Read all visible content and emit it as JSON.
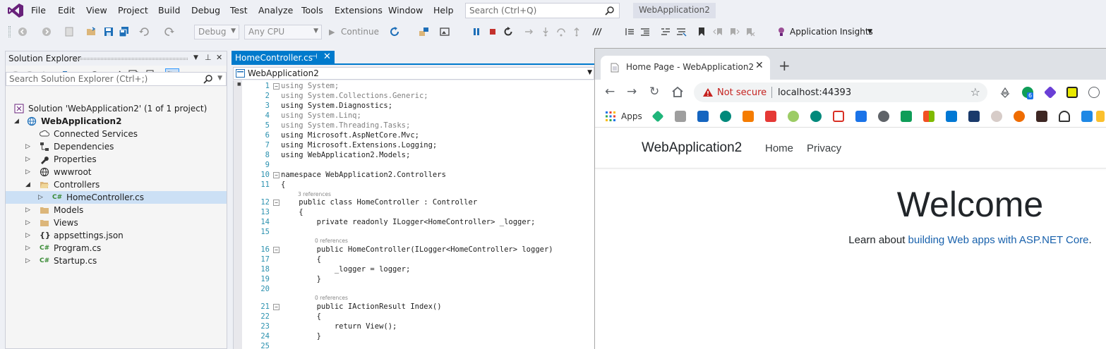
{
  "vs": {
    "menu": [
      "File",
      "Edit",
      "View",
      "Project",
      "Build",
      "Debug",
      "Test",
      "Analyze",
      "Tools",
      "Extensions",
      "Window",
      "Help"
    ],
    "search_placeholder": "Search (Ctrl+Q)",
    "window_title": "WebApplication2",
    "toolbar": {
      "config": "Debug",
      "platform": "Any CPU",
      "continue": "Continue",
      "app_insights": "Application Insights"
    },
    "accent": "#007acc"
  },
  "solution_explorer": {
    "title": "Solution Explorer",
    "search_placeholder": "Search Solution Explorer (Ctrl+;)",
    "items": [
      {
        "label": "Solution 'WebApplication2' (1 of 1 project)",
        "icon": "solution-icon"
      },
      {
        "label": "WebApplication2",
        "icon": "web-project-icon"
      },
      {
        "label": "Connected Services",
        "icon": "connected-services-icon"
      },
      {
        "label": "Dependencies",
        "icon": "dependencies-icon"
      },
      {
        "label": "Properties",
        "icon": "wrench-icon"
      },
      {
        "label": "wwwroot",
        "icon": "globe-icon"
      },
      {
        "label": "Controllers",
        "icon": "folder-open-icon"
      },
      {
        "label": "HomeController.cs",
        "icon": "csharp-file-icon"
      },
      {
        "label": "Models",
        "icon": "folder-icon"
      },
      {
        "label": "Views",
        "icon": "folder-icon"
      },
      {
        "label": "appsettings.json",
        "icon": "json-file-icon"
      },
      {
        "label": "Program.cs",
        "icon": "csharp-file-icon"
      },
      {
        "label": "Startup.cs",
        "icon": "csharp-file-icon"
      }
    ]
  },
  "editor": {
    "tab_label": "HomeController.cs",
    "nav_label": "WebApplication2",
    "codelens": [
      "3 references",
      "0 references",
      "0 references"
    ],
    "lines": [
      {
        "n": "1",
        "text": "using System;"
      },
      {
        "n": "2",
        "text": "using System.Collections.Generic;"
      },
      {
        "n": "3",
        "text": "using System.Diagnostics;"
      },
      {
        "n": "4",
        "text": "using System.Linq;"
      },
      {
        "n": "5",
        "text": "using System.Threading.Tasks;"
      },
      {
        "n": "6",
        "text": "using Microsoft.AspNetCore.Mvc;"
      },
      {
        "n": "7",
        "text": "using Microsoft.Extensions.Logging;"
      },
      {
        "n": "8",
        "text": "using WebApplication2.Models;"
      },
      {
        "n": "9",
        "text": ""
      },
      {
        "n": "10",
        "text": "namespace WebApplication2.Controllers"
      },
      {
        "n": "11",
        "text": "{"
      },
      {
        "n": "12",
        "text": "    public class HomeController : Controller"
      },
      {
        "n": "13",
        "text": "    {"
      },
      {
        "n": "14",
        "text": "        private readonly ILogger<HomeController> _logger;"
      },
      {
        "n": "15",
        "text": ""
      },
      {
        "n": "16",
        "text": "        public HomeController(ILogger<HomeController> logger)"
      },
      {
        "n": "17",
        "text": "        {"
      },
      {
        "n": "18",
        "text": "            _logger = logger;"
      },
      {
        "n": "19",
        "text": "        }"
      },
      {
        "n": "20",
        "text": ""
      },
      {
        "n": "21",
        "text": "        public IActionResult Index()"
      },
      {
        "n": "22",
        "text": "        {"
      },
      {
        "n": "23",
        "text": "            return View();"
      },
      {
        "n": "24",
        "text": "        }"
      },
      {
        "n": "25",
        "text": ""
      }
    ]
  },
  "browser": {
    "tab_title": "Home Page - WebApplication2",
    "security": "Not secure",
    "url": "localhost:44393",
    "extension_badge": "6",
    "bookmarks_apps": "Apps",
    "site": {
      "brand": "WebApplication2",
      "nav": [
        "Home",
        "Privacy"
      ],
      "heading": "Welcome",
      "learn_prefix": "Learn about ",
      "learn_link": "building Web apps with ASP.NET Core",
      "learn_suffix": "."
    },
    "link_color": "#1861ac",
    "warning_color": "#c5221f"
  }
}
